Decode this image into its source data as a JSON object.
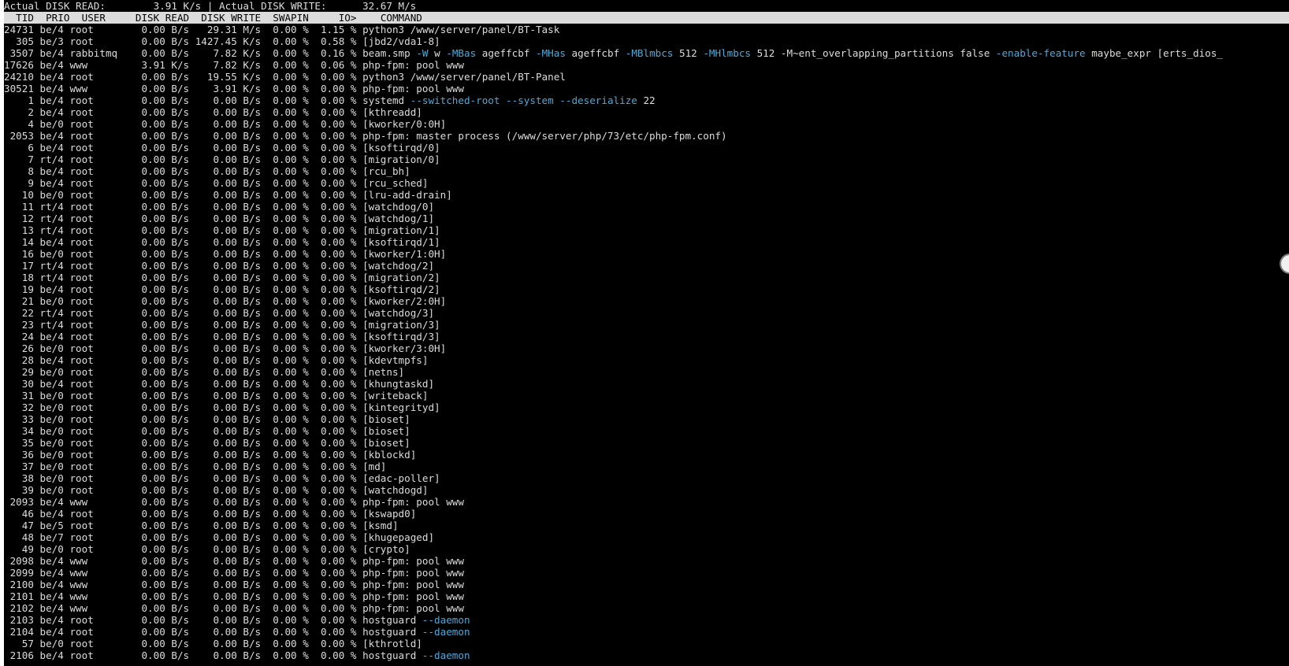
{
  "summary": {
    "read_label": "Actual DISK READ:",
    "read_value": "3.91 K/s",
    "separator": "|",
    "write_label": "Actual DISK WRITE:",
    "write_value": "32.67 M/s"
  },
  "columns": [
    "TID",
    "PRIO",
    "USER",
    "DISK READ",
    "DISK WRITE",
    "SWAPIN",
    "IO>",
    "COMMAND"
  ],
  "theme": {
    "background": "#000000",
    "foreground": "#dcdcdc",
    "header_bg": "#dcdcdc",
    "header_fg": "#000000",
    "option_color": "#4ea9d9"
  },
  "rows": [
    {
      "tid": "24731",
      "prio": "be/4",
      "user": "root",
      "read": "0.00 B/s",
      "write": "29.31 M/s",
      "swapin": "0.00 %",
      "io": "1.15 %",
      "cmd": [
        {
          "t": "python3 /www/server/panel/BT-Task"
        }
      ]
    },
    {
      "tid": "305",
      "prio": "be/3",
      "user": "root",
      "read": "0.00 B/s",
      "write": "1427.45 K/s",
      "swapin": "0.00 %",
      "io": "0.58 %",
      "cmd": [
        {
          "t": "[jbd2/vda1-8]"
        }
      ]
    },
    {
      "tid": "3507",
      "prio": "be/4",
      "user": "rabbitmq",
      "read": "0.00 B/s",
      "write": "7.82 K/s",
      "swapin": "0.00 %",
      "io": "0.16 %",
      "cmd": [
        {
          "t": "beam.smp "
        },
        {
          "t": "-W",
          "o": true
        },
        {
          "t": " w "
        },
        {
          "t": "-MBas",
          "o": true
        },
        {
          "t": " ageffcbf "
        },
        {
          "t": "-MHas",
          "o": true
        },
        {
          "t": " ageffcbf "
        },
        {
          "t": "-MBlmbcs",
          "o": true
        },
        {
          "t": " 512 "
        },
        {
          "t": "-MHlmbcs",
          "o": true
        },
        {
          "t": " 512 -M~ent_overlapping_partitions false "
        },
        {
          "t": "-enable-feature",
          "o": true
        },
        {
          "t": " maybe_expr [erts_dios_"
        }
      ]
    },
    {
      "tid": "17626",
      "prio": "be/4",
      "user": "www",
      "read": "3.91 K/s",
      "write": "7.82 K/s",
      "swapin": "0.00 %",
      "io": "0.06 %",
      "cmd": [
        {
          "t": "php-fpm: pool www"
        }
      ]
    },
    {
      "tid": "24210",
      "prio": "be/4",
      "user": "root",
      "read": "0.00 B/s",
      "write": "19.55 K/s",
      "swapin": "0.00 %",
      "io": "0.00 %",
      "cmd": [
        {
          "t": "python3 /www/server/panel/BT-Panel"
        }
      ]
    },
    {
      "tid": "30521",
      "prio": "be/4",
      "user": "www",
      "read": "0.00 B/s",
      "write": "3.91 K/s",
      "swapin": "0.00 %",
      "io": "0.00 %",
      "cmd": [
        {
          "t": "php-fpm: pool www"
        }
      ]
    },
    {
      "tid": "1",
      "prio": "be/4",
      "user": "root",
      "read": "0.00 B/s",
      "write": "0.00 B/s",
      "swapin": "0.00 %",
      "io": "0.00 %",
      "cmd": [
        {
          "t": "systemd "
        },
        {
          "t": "--switched-root --system --deserialize",
          "o": true
        },
        {
          "t": " 22"
        }
      ]
    },
    {
      "tid": "2",
      "prio": "be/4",
      "user": "root",
      "read": "0.00 B/s",
      "write": "0.00 B/s",
      "swapin": "0.00 %",
      "io": "0.00 %",
      "cmd": [
        {
          "t": "[kthreadd]"
        }
      ]
    },
    {
      "tid": "4",
      "prio": "be/0",
      "user": "root",
      "read": "0.00 B/s",
      "write": "0.00 B/s",
      "swapin": "0.00 %",
      "io": "0.00 %",
      "cmd": [
        {
          "t": "[kworker/0:0H]"
        }
      ]
    },
    {
      "tid": "2053",
      "prio": "be/4",
      "user": "root",
      "read": "0.00 B/s",
      "write": "0.00 B/s",
      "swapin": "0.00 %",
      "io": "0.00 %",
      "cmd": [
        {
          "t": "php-fpm: master process (/www/server/php/73/etc/php-fpm.conf)"
        }
      ]
    },
    {
      "tid": "6",
      "prio": "be/4",
      "user": "root",
      "read": "0.00 B/s",
      "write": "0.00 B/s",
      "swapin": "0.00 %",
      "io": "0.00 %",
      "cmd": [
        {
          "t": "[ksoftirqd/0]"
        }
      ]
    },
    {
      "tid": "7",
      "prio": "rt/4",
      "user": "root",
      "read": "0.00 B/s",
      "write": "0.00 B/s",
      "swapin": "0.00 %",
      "io": "0.00 %",
      "cmd": [
        {
          "t": "[migration/0]"
        }
      ]
    },
    {
      "tid": "8",
      "prio": "be/4",
      "user": "root",
      "read": "0.00 B/s",
      "write": "0.00 B/s",
      "swapin": "0.00 %",
      "io": "0.00 %",
      "cmd": [
        {
          "t": "[rcu_bh]"
        }
      ]
    },
    {
      "tid": "9",
      "prio": "be/4",
      "user": "root",
      "read": "0.00 B/s",
      "write": "0.00 B/s",
      "swapin": "0.00 %",
      "io": "0.00 %",
      "cmd": [
        {
          "t": "[rcu_sched]"
        }
      ]
    },
    {
      "tid": "10",
      "prio": "be/0",
      "user": "root",
      "read": "0.00 B/s",
      "write": "0.00 B/s",
      "swapin": "0.00 %",
      "io": "0.00 %",
      "cmd": [
        {
          "t": "[lru-add-drain]"
        }
      ]
    },
    {
      "tid": "11",
      "prio": "rt/4",
      "user": "root",
      "read": "0.00 B/s",
      "write": "0.00 B/s",
      "swapin": "0.00 %",
      "io": "0.00 %",
      "cmd": [
        {
          "t": "[watchdog/0]"
        }
      ]
    },
    {
      "tid": "12",
      "prio": "rt/4",
      "user": "root",
      "read": "0.00 B/s",
      "write": "0.00 B/s",
      "swapin": "0.00 %",
      "io": "0.00 %",
      "cmd": [
        {
          "t": "[watchdog/1]"
        }
      ]
    },
    {
      "tid": "13",
      "prio": "rt/4",
      "user": "root",
      "read": "0.00 B/s",
      "write": "0.00 B/s",
      "swapin": "0.00 %",
      "io": "0.00 %",
      "cmd": [
        {
          "t": "[migration/1]"
        }
      ]
    },
    {
      "tid": "14",
      "prio": "be/4",
      "user": "root",
      "read": "0.00 B/s",
      "write": "0.00 B/s",
      "swapin": "0.00 %",
      "io": "0.00 %",
      "cmd": [
        {
          "t": "[ksoftirqd/1]"
        }
      ]
    },
    {
      "tid": "16",
      "prio": "be/0",
      "user": "root",
      "read": "0.00 B/s",
      "write": "0.00 B/s",
      "swapin": "0.00 %",
      "io": "0.00 %",
      "cmd": [
        {
          "t": "[kworker/1:0H]"
        }
      ]
    },
    {
      "tid": "17",
      "prio": "rt/4",
      "user": "root",
      "read": "0.00 B/s",
      "write": "0.00 B/s",
      "swapin": "0.00 %",
      "io": "0.00 %",
      "cmd": [
        {
          "t": "[watchdog/2]"
        }
      ]
    },
    {
      "tid": "18",
      "prio": "rt/4",
      "user": "root",
      "read": "0.00 B/s",
      "write": "0.00 B/s",
      "swapin": "0.00 %",
      "io": "0.00 %",
      "cmd": [
        {
          "t": "[migration/2]"
        }
      ]
    },
    {
      "tid": "19",
      "prio": "be/4",
      "user": "root",
      "read": "0.00 B/s",
      "write": "0.00 B/s",
      "swapin": "0.00 %",
      "io": "0.00 %",
      "cmd": [
        {
          "t": "[ksoftirqd/2]"
        }
      ]
    },
    {
      "tid": "21",
      "prio": "be/0",
      "user": "root",
      "read": "0.00 B/s",
      "write": "0.00 B/s",
      "swapin": "0.00 %",
      "io": "0.00 %",
      "cmd": [
        {
          "t": "[kworker/2:0H]"
        }
      ]
    },
    {
      "tid": "22",
      "prio": "rt/4",
      "user": "root",
      "read": "0.00 B/s",
      "write": "0.00 B/s",
      "swapin": "0.00 %",
      "io": "0.00 %",
      "cmd": [
        {
          "t": "[watchdog/3]"
        }
      ]
    },
    {
      "tid": "23",
      "prio": "rt/4",
      "user": "root",
      "read": "0.00 B/s",
      "write": "0.00 B/s",
      "swapin": "0.00 %",
      "io": "0.00 %",
      "cmd": [
        {
          "t": "[migration/3]"
        }
      ]
    },
    {
      "tid": "24",
      "prio": "be/4",
      "user": "root",
      "read": "0.00 B/s",
      "write": "0.00 B/s",
      "swapin": "0.00 %",
      "io": "0.00 %",
      "cmd": [
        {
          "t": "[ksoftirqd/3]"
        }
      ]
    },
    {
      "tid": "26",
      "prio": "be/0",
      "user": "root",
      "read": "0.00 B/s",
      "write": "0.00 B/s",
      "swapin": "0.00 %",
      "io": "0.00 %",
      "cmd": [
        {
          "t": "[kworker/3:0H]"
        }
      ]
    },
    {
      "tid": "28",
      "prio": "be/4",
      "user": "root",
      "read": "0.00 B/s",
      "write": "0.00 B/s",
      "swapin": "0.00 %",
      "io": "0.00 %",
      "cmd": [
        {
          "t": "[kdevtmpfs]"
        }
      ]
    },
    {
      "tid": "29",
      "prio": "be/0",
      "user": "root",
      "read": "0.00 B/s",
      "write": "0.00 B/s",
      "swapin": "0.00 %",
      "io": "0.00 %",
      "cmd": [
        {
          "t": "[netns]"
        }
      ]
    },
    {
      "tid": "30",
      "prio": "be/4",
      "user": "root",
      "read": "0.00 B/s",
      "write": "0.00 B/s",
      "swapin": "0.00 %",
      "io": "0.00 %",
      "cmd": [
        {
          "t": "[khungtaskd]"
        }
      ]
    },
    {
      "tid": "31",
      "prio": "be/0",
      "user": "root",
      "read": "0.00 B/s",
      "write": "0.00 B/s",
      "swapin": "0.00 %",
      "io": "0.00 %",
      "cmd": [
        {
          "t": "[writeback]"
        }
      ]
    },
    {
      "tid": "32",
      "prio": "be/0",
      "user": "root",
      "read": "0.00 B/s",
      "write": "0.00 B/s",
      "swapin": "0.00 %",
      "io": "0.00 %",
      "cmd": [
        {
          "t": "[kintegrityd]"
        }
      ]
    },
    {
      "tid": "33",
      "prio": "be/0",
      "user": "root",
      "read": "0.00 B/s",
      "write": "0.00 B/s",
      "swapin": "0.00 %",
      "io": "0.00 %",
      "cmd": [
        {
          "t": "[bioset]"
        }
      ]
    },
    {
      "tid": "34",
      "prio": "be/0",
      "user": "root",
      "read": "0.00 B/s",
      "write": "0.00 B/s",
      "swapin": "0.00 %",
      "io": "0.00 %",
      "cmd": [
        {
          "t": "[bioset]"
        }
      ]
    },
    {
      "tid": "35",
      "prio": "be/0",
      "user": "root",
      "read": "0.00 B/s",
      "write": "0.00 B/s",
      "swapin": "0.00 %",
      "io": "0.00 %",
      "cmd": [
        {
          "t": "[bioset]"
        }
      ]
    },
    {
      "tid": "36",
      "prio": "be/0",
      "user": "root",
      "read": "0.00 B/s",
      "write": "0.00 B/s",
      "swapin": "0.00 %",
      "io": "0.00 %",
      "cmd": [
        {
          "t": "[kblockd]"
        }
      ]
    },
    {
      "tid": "37",
      "prio": "be/0",
      "user": "root",
      "read": "0.00 B/s",
      "write": "0.00 B/s",
      "swapin": "0.00 %",
      "io": "0.00 %",
      "cmd": [
        {
          "t": "[md]"
        }
      ]
    },
    {
      "tid": "38",
      "prio": "be/0",
      "user": "root",
      "read": "0.00 B/s",
      "write": "0.00 B/s",
      "swapin": "0.00 %",
      "io": "0.00 %",
      "cmd": [
        {
          "t": "[edac-poller]"
        }
      ]
    },
    {
      "tid": "39",
      "prio": "be/0",
      "user": "root",
      "read": "0.00 B/s",
      "write": "0.00 B/s",
      "swapin": "0.00 %",
      "io": "0.00 %",
      "cmd": [
        {
          "t": "[watchdogd]"
        }
      ]
    },
    {
      "tid": "2093",
      "prio": "be/4",
      "user": "www",
      "read": "0.00 B/s",
      "write": "0.00 B/s",
      "swapin": "0.00 %",
      "io": "0.00 %",
      "cmd": [
        {
          "t": "php-fpm: pool www"
        }
      ]
    },
    {
      "tid": "46",
      "prio": "be/4",
      "user": "root",
      "read": "0.00 B/s",
      "write": "0.00 B/s",
      "swapin": "0.00 %",
      "io": "0.00 %",
      "cmd": [
        {
          "t": "[kswapd0]"
        }
      ]
    },
    {
      "tid": "47",
      "prio": "be/5",
      "user": "root",
      "read": "0.00 B/s",
      "write": "0.00 B/s",
      "swapin": "0.00 %",
      "io": "0.00 %",
      "cmd": [
        {
          "t": "[ksmd]"
        }
      ]
    },
    {
      "tid": "48",
      "prio": "be/7",
      "user": "root",
      "read": "0.00 B/s",
      "write": "0.00 B/s",
      "swapin": "0.00 %",
      "io": "0.00 %",
      "cmd": [
        {
          "t": "[khugepaged]"
        }
      ]
    },
    {
      "tid": "49",
      "prio": "be/0",
      "user": "root",
      "read": "0.00 B/s",
      "write": "0.00 B/s",
      "swapin": "0.00 %",
      "io": "0.00 %",
      "cmd": [
        {
          "t": "[crypto]"
        }
      ]
    },
    {
      "tid": "2098",
      "prio": "be/4",
      "user": "www",
      "read": "0.00 B/s",
      "write": "0.00 B/s",
      "swapin": "0.00 %",
      "io": "0.00 %",
      "cmd": [
        {
          "t": "php-fpm: pool www"
        }
      ]
    },
    {
      "tid": "2099",
      "prio": "be/4",
      "user": "www",
      "read": "0.00 B/s",
      "write": "0.00 B/s",
      "swapin": "0.00 %",
      "io": "0.00 %",
      "cmd": [
        {
          "t": "php-fpm: pool www"
        }
      ]
    },
    {
      "tid": "2100",
      "prio": "be/4",
      "user": "www",
      "read": "0.00 B/s",
      "write": "0.00 B/s",
      "swapin": "0.00 %",
      "io": "0.00 %",
      "cmd": [
        {
          "t": "php-fpm: pool www"
        }
      ]
    },
    {
      "tid": "2101",
      "prio": "be/4",
      "user": "www",
      "read": "0.00 B/s",
      "write": "0.00 B/s",
      "swapin": "0.00 %",
      "io": "0.00 %",
      "cmd": [
        {
          "t": "php-fpm: pool www"
        }
      ]
    },
    {
      "tid": "2102",
      "prio": "be/4",
      "user": "www",
      "read": "0.00 B/s",
      "write": "0.00 B/s",
      "swapin": "0.00 %",
      "io": "0.00 %",
      "cmd": [
        {
          "t": "php-fpm: pool www"
        }
      ]
    },
    {
      "tid": "2103",
      "prio": "be/4",
      "user": "root",
      "read": "0.00 B/s",
      "write": "0.00 B/s",
      "swapin": "0.00 %",
      "io": "0.00 %",
      "cmd": [
        {
          "t": "hostguard "
        },
        {
          "t": "--daemon",
          "o": true
        }
      ]
    },
    {
      "tid": "2104",
      "prio": "be/4",
      "user": "root",
      "read": "0.00 B/s",
      "write": "0.00 B/s",
      "swapin": "0.00 %",
      "io": "0.00 %",
      "cmd": [
        {
          "t": "hostguard "
        },
        {
          "t": "--daemon",
          "o": true
        }
      ]
    },
    {
      "tid": "57",
      "prio": "be/0",
      "user": "root",
      "read": "0.00 B/s",
      "write": "0.00 B/s",
      "swapin": "0.00 %",
      "io": "0.00 %",
      "cmd": [
        {
          "t": "[kthrotld]"
        }
      ]
    },
    {
      "tid": "2106",
      "prio": "be/4",
      "user": "root",
      "read": "0.00 B/s",
      "write": "0.00 B/s",
      "swapin": "0.00 %",
      "io": "0.00 %",
      "cmd": [
        {
          "t": "hostguard "
        },
        {
          "t": "--daemon",
          "o": true
        }
      ]
    }
  ]
}
